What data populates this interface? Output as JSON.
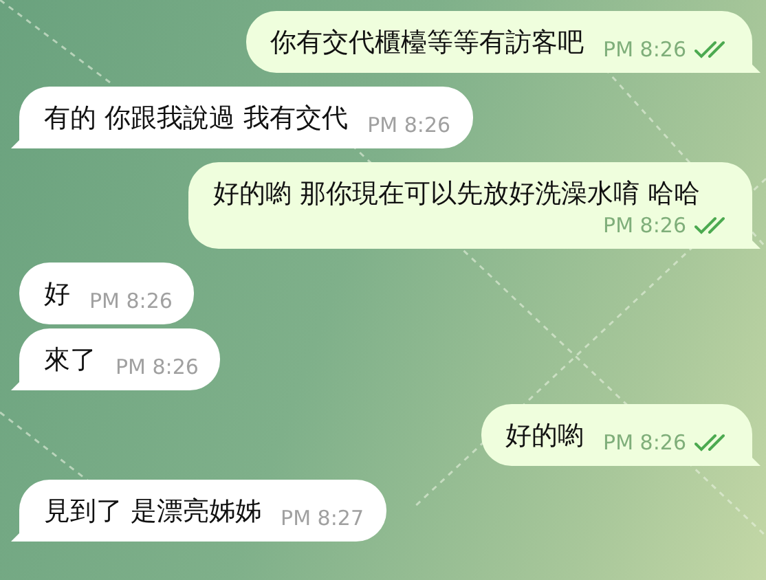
{
  "messages": [
    {
      "text": "你有交代櫃檯等等有訪客吧",
      "time": "PM 8:26",
      "outgoing": true,
      "read": true
    },
    {
      "text": "有的 你跟我說過 我有交代",
      "time": "PM 8:26",
      "outgoing": false
    },
    {
      "text": "好的喲 那你現在可以先放好洗澡水唷 哈哈",
      "time": "PM 8:26",
      "outgoing": true,
      "read": true
    },
    {
      "text": "好",
      "time": "PM 8:26",
      "outgoing": false
    },
    {
      "text": "來了",
      "time": "PM 8:26",
      "outgoing": false
    },
    {
      "text": "好的喲",
      "time": "PM 8:26",
      "outgoing": true,
      "read": true
    },
    {
      "text": "見到了 是漂亮姊姊",
      "time": "PM 8:27",
      "outgoing": false
    }
  ]
}
